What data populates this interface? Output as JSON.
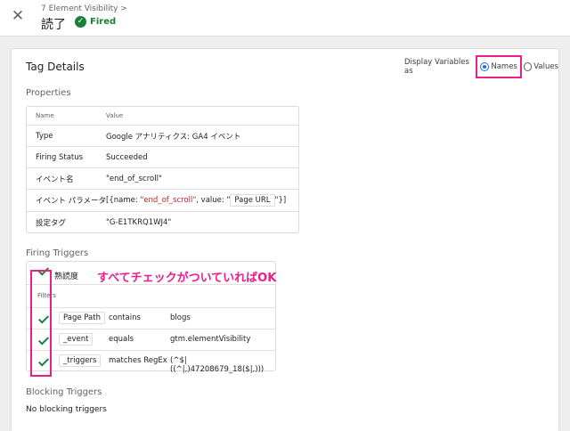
{
  "header": {
    "breadcrumb": "7 Element Visibility >",
    "title": "読了",
    "status_label": "Fired",
    "status_icon": "check-circle-icon",
    "close_icon": "close-icon"
  },
  "card": {
    "title": "Tag Details",
    "display_variables": {
      "label": "Display Variables as",
      "options": [
        "Names",
        "Values"
      ],
      "selected": "Names"
    }
  },
  "properties": {
    "section_title": "Properties",
    "columns": [
      "Name",
      "Value"
    ],
    "rows": [
      {
        "name": "Type",
        "value": "Google アナリティクス: GA4 イベント"
      },
      {
        "name": "Firing Status",
        "value": "Succeeded"
      },
      {
        "name": "イベント名",
        "value": "\"end_of_scroll\""
      },
      {
        "name": "イベント パラメータ",
        "value_prefix": "[{name: ",
        "value_name": "\"end_of_scroll\"",
        "value_mid": ", value: \"",
        "value_chip": "Page URL",
        "value_suffix": "\"}]"
      },
      {
        "name": "設定タグ",
        "value": "\"G-E1TKRQ1WJ4\""
      }
    ]
  },
  "firing_triggers": {
    "section_title": "Firing Triggers",
    "trigger_name": "熟読度",
    "filters_label": "Filters",
    "filters": [
      {
        "variable": "Page Path",
        "operator": "contains",
        "value": "blogs"
      },
      {
        "variable": "_event",
        "operator": "equals",
        "value": "gtm.elementVisibility"
      },
      {
        "variable": "_triggers",
        "operator": "matches RegEx",
        "value": "(^$|((^|,)47208679_18($|,)))"
      }
    ]
  },
  "annotation": "すべてチェックがついていればOK",
  "blocking_triggers": {
    "section_title": "Blocking Triggers",
    "empty_text": "No blocking triggers"
  },
  "colors": {
    "success": "#188038",
    "highlight": "#e91e8c",
    "value_red": "#c5221f",
    "accent": "#1a73e8"
  }
}
